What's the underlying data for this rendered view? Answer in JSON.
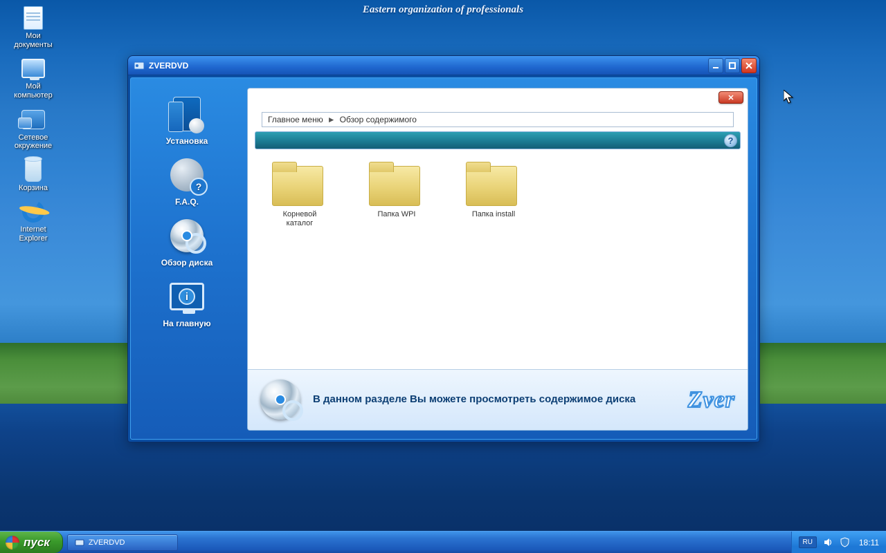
{
  "wallpaper_slogan": "Eastern organization of professionals",
  "desktop_icons": [
    {
      "id": "docs",
      "label": "Мои\nдокументы"
    },
    {
      "id": "pc",
      "label": "Мой\nкомпьютер"
    },
    {
      "id": "net",
      "label": "Сетевое\nокружение"
    },
    {
      "id": "bin",
      "label": "Корзина"
    },
    {
      "id": "ie",
      "label": "Internet\nExplorer"
    }
  ],
  "window": {
    "title": "ZVERDVD",
    "sidebar": [
      {
        "id": "install",
        "label": "Установка"
      },
      {
        "id": "faq",
        "label": "F.A.Q."
      },
      {
        "id": "review",
        "label": "Обзор диска"
      },
      {
        "id": "home",
        "label": "На главную"
      }
    ],
    "breadcrumb": {
      "root": "Главное меню",
      "leaf": "Обзор содержимого",
      "sep": "►"
    },
    "folders": [
      {
        "id": "root",
        "label": "Корневой\nкаталог"
      },
      {
        "id": "wpi",
        "label": "Папка WPI"
      },
      {
        "id": "inst",
        "label": "Папка install"
      }
    ],
    "info_text": "В данном разделе Вы можете просмотреть содержимое диска",
    "logo_text": "Zver"
  },
  "taskbar": {
    "start_label": "пуск",
    "task_label": "ZVERDVD",
    "lang": "RU",
    "clock": "18:11"
  }
}
